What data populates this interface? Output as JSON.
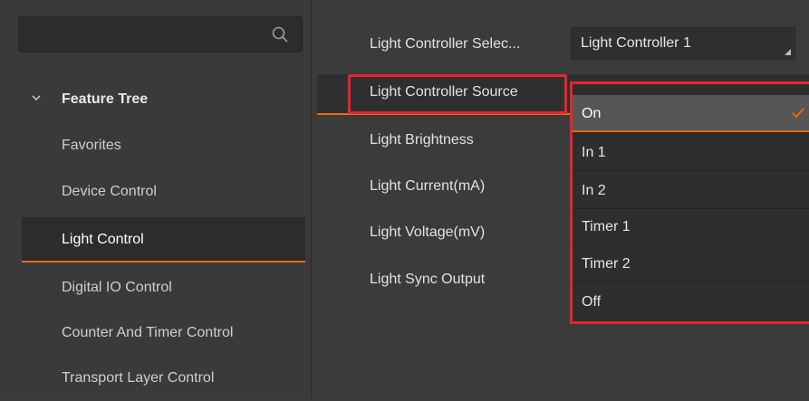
{
  "search": {
    "placeholder": ""
  },
  "feature_tree": {
    "title": "Feature Tree",
    "items": [
      {
        "label": "Favorites"
      },
      {
        "label": "Device Control"
      },
      {
        "label": "Light Control"
      },
      {
        "label": "Digital IO Control"
      },
      {
        "label": "Counter And Timer Control"
      },
      {
        "label": "Transport Layer Control"
      }
    ],
    "selected_index": 2
  },
  "properties": {
    "labels": [
      "Light Controller Selec...",
      "Light Controller Source",
      "Light Brightness",
      "Light Current(mA)",
      "Light Voltage(mV)",
      "Light Sync Output"
    ],
    "selector_value": "Light Controller 1"
  },
  "dropdown": {
    "options": [
      "On",
      "In 1",
      "In 2",
      "Timer 1",
      "Timer 2",
      "Off"
    ],
    "selected_index": 0
  },
  "colors": {
    "accent": "#e86a10",
    "annotation_red": "#e3262f"
  },
  "icons": {
    "search": "search-icon",
    "chevron": "chevron-down-icon",
    "check": "check-icon"
  }
}
